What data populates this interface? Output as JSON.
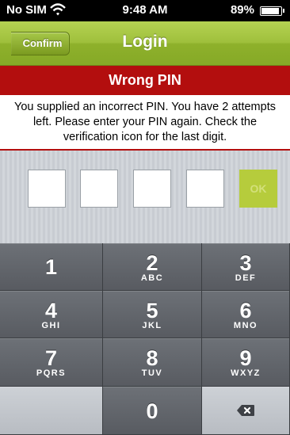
{
  "status_bar": {
    "carrier": "No SIM",
    "time": "9:48 AM",
    "battery": "89%"
  },
  "nav": {
    "back_label": "Confirm",
    "title": "Login"
  },
  "error": {
    "title": "Wrong PIN",
    "message": "You supplied an incorrect PIN. You have 2 attempts left. Please enter your PIN again. Check the verification icon for the last digit."
  },
  "pin": {
    "ok_label": "OK"
  },
  "keypad": {
    "keys": [
      {
        "num": "1",
        "letters": ""
      },
      {
        "num": "2",
        "letters": "ABC"
      },
      {
        "num": "3",
        "letters": "DEF"
      },
      {
        "num": "4",
        "letters": "GHI"
      },
      {
        "num": "5",
        "letters": "JKL"
      },
      {
        "num": "6",
        "letters": "MNO"
      },
      {
        "num": "7",
        "letters": "PQRS"
      },
      {
        "num": "8",
        "letters": "TUV"
      },
      {
        "num": "9",
        "letters": "WXYZ"
      },
      {
        "num": "0",
        "letters": ""
      }
    ]
  },
  "colors": {
    "nav_green": "#9fc03c",
    "error_red": "#b30e0e",
    "ok_green": "#b6cc3c",
    "keypad_dark": "#585b61"
  }
}
